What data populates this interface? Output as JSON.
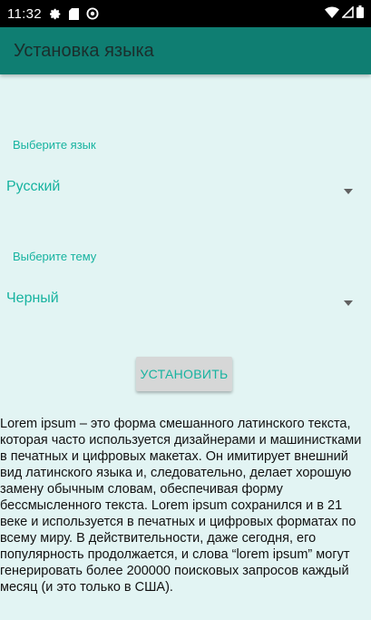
{
  "statusbar": {
    "time": "11:32",
    "icons_left": [
      "settings-icon",
      "sd-card-icon",
      "at-sign-icon"
    ],
    "icons_right": [
      "wifi-icon",
      "signal-icon",
      "battery-icon"
    ]
  },
  "appbar": {
    "title": "Установка языка"
  },
  "language": {
    "label": "Выберите язык",
    "selected": "Русский"
  },
  "theme": {
    "label": "Выберите тему",
    "selected": "Черный"
  },
  "install_button": {
    "label": "УСТАНОВИТЬ"
  },
  "description": "Lorem ipsum – это форма смешанного латинского текста, которая часто используется дизайнерами и машинистками в печатных и цифровых макетах. Он имитирует внешний вид латинского языка и, следовательно, делает хорошую замену обычным словам, обеспечивая форму бессмысленного текста. Lorem ipsum сохранился и в 21 веке и используется в печатных и цифровых форматах по всему миру. В действительности, даже сегодня, его популярность продолжается, и слова “lorem ipsum” могут генерировать более 200000 поисковых запросов каждый месяц (и это только в США).",
  "colors": {
    "accent": "#17b3a0",
    "appbar": "#0f7e72",
    "background": "#e2f4f3",
    "button": "#d6d7d7"
  }
}
